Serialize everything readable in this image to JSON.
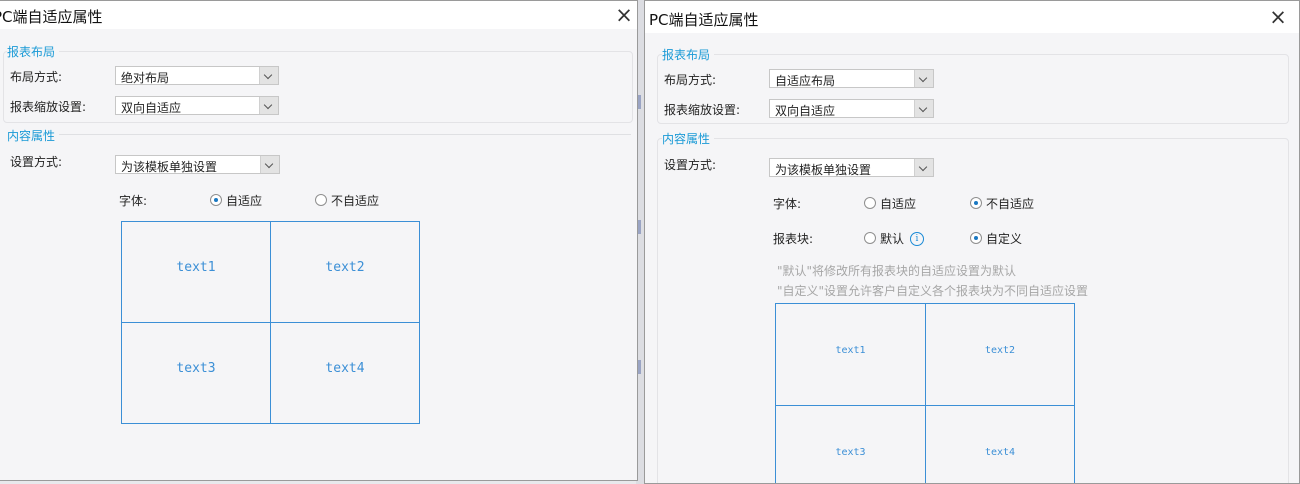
{
  "left_dialog": {
    "title": "PC端自适应属性",
    "close_symbol": "×",
    "layout_section": {
      "title": "报表布局",
      "layout_mode_label": "布局方式:",
      "layout_mode_value": "绝对布局",
      "scale_label": "报表缩放设置:",
      "scale_value": "双向自适应"
    },
    "content_section": {
      "title": "内容属性",
      "setting_label": "设置方式:",
      "setting_value": "为该模板单独设置",
      "font_label": "字体:",
      "font_options": [
        {
          "label": "自适应",
          "selected": true
        },
        {
          "label": "不自适应",
          "selected": false
        }
      ]
    },
    "preview_cells": [
      "text1",
      "text2",
      "text3",
      "text4"
    ]
  },
  "right_dialog": {
    "title": "PC端自适应属性",
    "close_symbol": "×",
    "layout_section": {
      "title": "报表布局",
      "layout_mode_label": "布局方式:",
      "layout_mode_value": "自适应布局",
      "scale_label": "报表缩放设置:",
      "scale_value": "双向自适应"
    },
    "content_section": {
      "title": "内容属性",
      "setting_label": "设置方式:",
      "setting_value": "为该模板单独设置",
      "font_label": "字体:",
      "font_options": [
        {
          "label": "自适应",
          "selected": false
        },
        {
          "label": "不自适应",
          "selected": true
        }
      ],
      "block_label": "报表块:",
      "block_options": [
        {
          "label": "默认",
          "selected": false
        },
        {
          "label": "自定义",
          "selected": true
        }
      ],
      "info_icon_glyph": "i",
      "hint_line_1": "\"默认\"将修改所有报表块的自适应设置为默认",
      "hint_line_2": "\"自定义\"设置允许客户自定义各个报表块为不同自适应设置"
    },
    "preview_cells": [
      "text1",
      "text2",
      "text3",
      "text4"
    ]
  },
  "colors": {
    "accent": "#1a9ad6",
    "grid_line": "#3b8fd6",
    "dialog_bg": "#f5f5f7",
    "hint_text": "#a6a6a6"
  }
}
